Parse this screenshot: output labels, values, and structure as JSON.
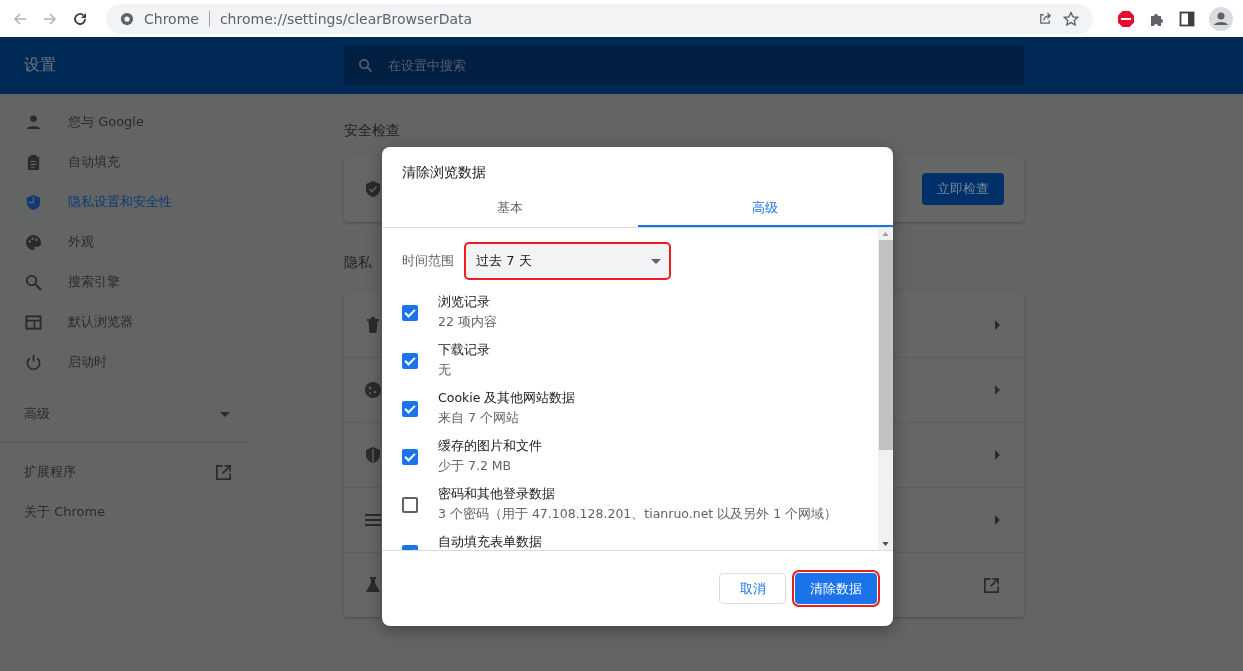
{
  "browser": {
    "site_label": "Chrome",
    "url": "chrome://settings/clearBrowserData",
    "back_disabled": true,
    "forward_disabled": true
  },
  "header": {
    "title": "设置",
    "search": {
      "placeholder": "在设置中搜索"
    }
  },
  "sidebar": {
    "items": [
      {
        "label": "您与 Google",
        "selected": false
      },
      {
        "label": "自动填充",
        "selected": false
      },
      {
        "label": "隐私设置和安全性",
        "selected": true
      },
      {
        "label": "外观",
        "selected": false
      },
      {
        "label": "搜索引擎",
        "selected": false
      },
      {
        "label": "默认浏览器",
        "selected": false
      },
      {
        "label": "启动时",
        "selected": false
      }
    ],
    "advanced": {
      "label": "高级",
      "expanded": false
    },
    "links": [
      {
        "label": "扩展程序",
        "external": true
      },
      {
        "label": "关于 Chrome",
        "external": false
      }
    ]
  },
  "sections": [
    {
      "title": "安全检查",
      "button": "立即检查"
    },
    {
      "title": "隐私"
    }
  ],
  "privacy_rows": [
    {
      "kind": "arrow"
    },
    {
      "kind": "arrow"
    },
    {
      "kind": "arrow"
    },
    {
      "kind": "arrow"
    },
    {
      "kind": "external"
    }
  ],
  "dialog": {
    "title": "清除浏览数据",
    "tabs": [
      {
        "label": "基本",
        "selected": false
      },
      {
        "label": "高级",
        "selected": true
      }
    ],
    "time_range": {
      "label": "时间范围",
      "value": "过去 7 天",
      "annotated": true
    },
    "items": [
      {
        "label": "浏览记录",
        "detail": "22 项内容",
        "checked": true
      },
      {
        "label": "下载记录",
        "detail": "无",
        "checked": true
      },
      {
        "label": "Cookie 及其他网站数据",
        "detail": "来自 7 个网站",
        "checked": true
      },
      {
        "label": "缓存的图片和文件",
        "detail": "少于 7.2 MB",
        "checked": true
      },
      {
        "label": "密码和其他登录数据",
        "detail": "3 个密码（用于 47.108.128.201、tianruo.net 以及另外 1 个网域）",
        "checked": false
      },
      {
        "label": "自动填充表单数据",
        "checked": true
      }
    ],
    "buttons": [
      {
        "label": "取消",
        "kind": "secondary",
        "annotated": false
      },
      {
        "label": "清除数据",
        "kind": "primary",
        "annotated": true
      }
    ]
  }
}
